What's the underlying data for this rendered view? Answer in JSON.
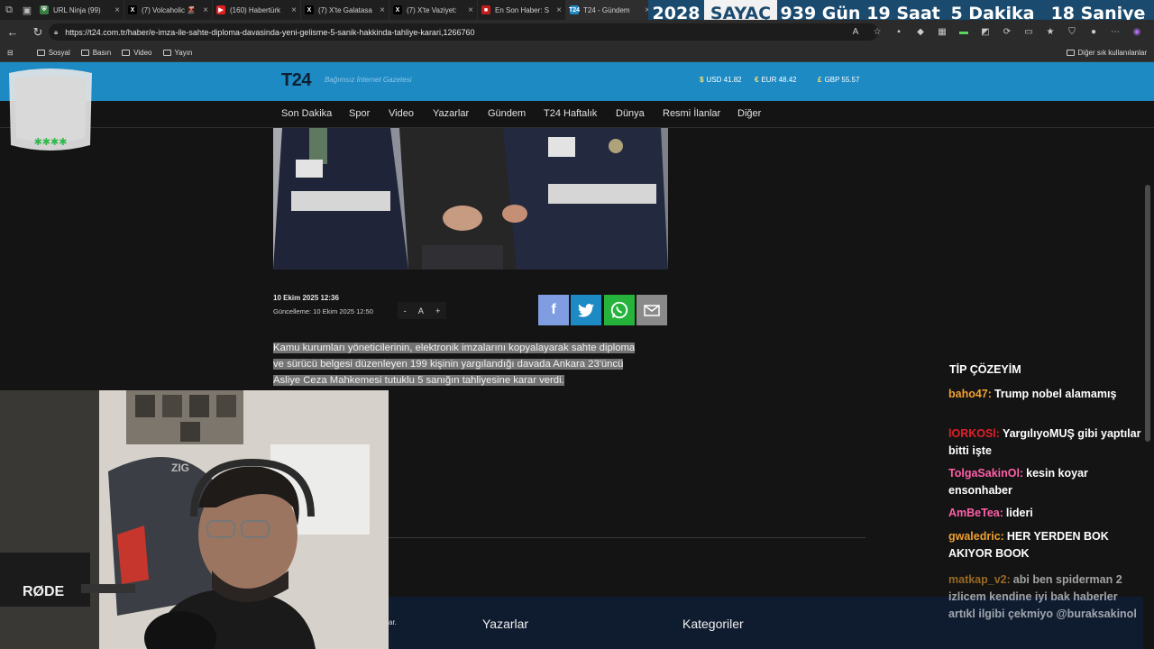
{
  "browser": {
    "tabs": [
      {
        "title": "URL Ninja (99)",
        "fav_color": "#3a7d44",
        "fav_text": "⛨"
      },
      {
        "title": "(7) Volcaholic 🌋",
        "fav_color": "#000000",
        "fav_text": "X"
      },
      {
        "title": "(160) Habertürk",
        "fav_color": "#e02020",
        "fav_text": "▶"
      },
      {
        "title": "(7) X'te Galatasa",
        "fav_color": "#000000",
        "fav_text": "X"
      },
      {
        "title": "(7) X'te Vaziyet:",
        "fav_color": "#000000",
        "fav_text": "X"
      },
      {
        "title": "En Son Haber: S",
        "fav_color": "#c21d1d",
        "fav_text": "■"
      },
      {
        "title": "T24 - Gündem",
        "fav_color": "#1d8ac4",
        "fav_text": "T24"
      }
    ],
    "url": "https://t24.com.tr/haber/e-imza-ile-sahte-diploma-davasinda-yeni-gelisme-5-sanik-hakkinda-tahliye-karari,1266760",
    "bookmarks": [
      "Sosyal",
      "Basın",
      "Video",
      "Yayın"
    ],
    "other_bookmarks": "Diğer sık kullanılanlar"
  },
  "countdown": {
    "year": "2028",
    "label": "SAYAÇ",
    "days": "939 Gün",
    "hours": "19 Saat",
    "minutes": "5 Dakika",
    "seconds": "18 Saniye"
  },
  "site": {
    "logo": "T24",
    "tagline": "Bağımsız İnternet Gazetesi",
    "currency": [
      {
        "symbol": "$",
        "label": "USD 41.82"
      },
      {
        "symbol": "€",
        "label": "EUR 48.42"
      },
      {
        "symbol": "£",
        "label": "GBP 55.57"
      }
    ],
    "nav": [
      "Son Dakika",
      "Spor",
      "Video",
      "Yazarlar",
      "Gündem",
      "T24 Haftalık",
      "Dünya",
      "Resmi İlanlar",
      "Diğer"
    ]
  },
  "article": {
    "date": "10 Ekim 2025 12:36",
    "updated": "Güncelleme: 10 Ekim 2025 12:50",
    "font_minus": "-",
    "font_a": "A",
    "font_plus": "+",
    "body_lines": [
      "Kamu kurumları yöneticilerinin, elektronik imzalarını kopyalayarak sahte diploma",
      "ve sürücü belgesi düzenleyen 199 kişinin yargılandığı davada Ankara 23'üncü",
      "Asliye Ceza Mahkemesi tutuklu 5 sanığın tahliyesine karar verdi."
    ]
  },
  "footer": {
    "fragment": "ar.",
    "writers": "Yazarlar",
    "categories": "Kategoriler"
  },
  "webcam": {
    "mic_brand": "RØDE",
    "chair_brand": "ZIG"
  },
  "chat": {
    "title": "TİP ÇÖZEYİM",
    "messages": [
      {
        "user": "baho47:",
        "text": "Trump nobel alamamış",
        "color": "#f0a030"
      },
      {
        "user": "lORKOSl:",
        "text": "YargılıyoMUŞ gibi yaptılar bitti işte",
        "color": "#e0202a"
      },
      {
        "user": "TolgaSakinOl:",
        "text": "kesin koyar ensonhaber",
        "color": "#ff5fa8"
      },
      {
        "user": "AmBeTea:",
        "text": "lideri",
        "color": "#ff5fa8"
      },
      {
        "user": "gwaledric:",
        "text": "HER YERDEN BOK AKIYOR BOOK",
        "color": "#f0a030"
      },
      {
        "user": "matkap_v2:",
        "text": "abi ben spiderman 2 izlicem kendine iyi bak haberler artıkl ilgibi çekmiyo @buraksakinol",
        "color": "#f0a030"
      }
    ]
  },
  "colors": {
    "site_blue": "#1d8ac4",
    "countdown_blue": "#1a4a6e",
    "facebook": "#7f9de0",
    "twitter": "#1d8ac4",
    "whatsapp": "#25b33c",
    "email": "#8a8a8a"
  },
  "icons": [
    "back-icon",
    "reload-icon",
    "lock-icon",
    "facebook-icon",
    "twitter-icon",
    "whatsapp-icon",
    "email-icon",
    "folder-icon"
  ]
}
